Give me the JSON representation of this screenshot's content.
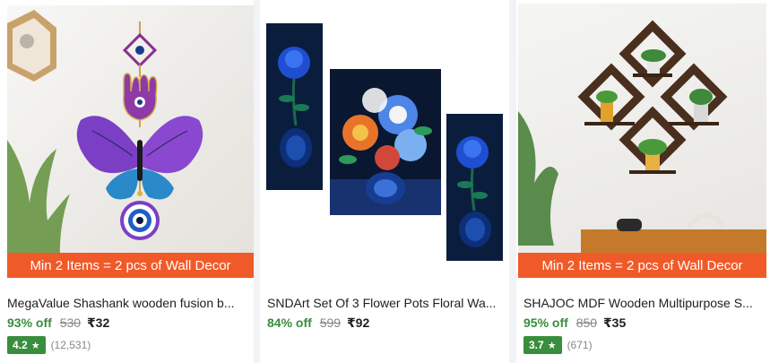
{
  "products": [
    {
      "promo": "Min 2 Items = 2 pcs of Wall Decor",
      "title": "MegaValue Shashank wooden fusion b...",
      "discount": "93% off",
      "mrp": "530",
      "price": "₹32",
      "rating": "4.2",
      "rating_count": "(12,531)"
    },
    {
      "title": "SNDArt Set Of 3 Flower Pots Floral Wa...",
      "discount": "84% off",
      "mrp": "599",
      "price": "₹92"
    },
    {
      "promo": "Min 2 Items = 2 pcs of Wall Decor",
      "title": "SHAJOC MDF Wooden Multipurpose S...",
      "discount": "95% off",
      "mrp": "850",
      "price": "₹35",
      "rating": "3.7",
      "rating_count": "(671)"
    }
  ],
  "icons": {
    "rating": "star-icon"
  },
  "colors": {
    "promo_bg": "#f05a28",
    "discount": "#388e3c",
    "rating_bg": "#388e3c"
  }
}
